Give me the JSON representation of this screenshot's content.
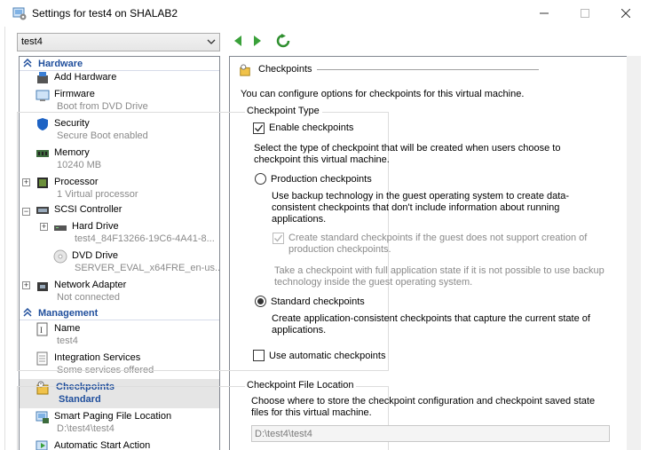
{
  "window": {
    "title": "Settings for test4 on SHALAB2"
  },
  "vm_selector": {
    "value": "test4"
  },
  "tree": {
    "hardware_label": "Hardware",
    "add_hardware": "Add Hardware",
    "firmware": {
      "name": "Firmware",
      "sub": "Boot from DVD Drive"
    },
    "security": {
      "name": "Security",
      "sub": "Secure Boot enabled"
    },
    "memory": {
      "name": "Memory",
      "sub": "10240 MB"
    },
    "processor": {
      "name": "Processor",
      "sub": "1 Virtual processor"
    },
    "scsi": {
      "name": "SCSI Controller"
    },
    "hard_drive": {
      "name": "Hard Drive",
      "sub": "test4_84F13266-19C6-4A41-8..."
    },
    "dvd_drive": {
      "name": "DVD Drive",
      "sub": "SERVER_EVAL_x64FRE_en-us...."
    },
    "network": {
      "name": "Network Adapter",
      "sub": "Not connected"
    },
    "management_label": "Management",
    "name_item": {
      "name": "Name",
      "sub": "test4"
    },
    "integration": {
      "name": "Integration Services",
      "sub": "Some services offered"
    },
    "checkpoints": {
      "name": "Checkpoints",
      "sub": "Standard"
    },
    "smart_paging": {
      "name": "Smart Paging File Location",
      "sub": "D:\\test4\\test4"
    },
    "auto_start": {
      "name": "Automatic Start Action"
    }
  },
  "panel": {
    "heading": "Checkpoints",
    "intro": "You can configure options for checkpoints for this virtual machine.",
    "checkpoint_type_legend": "Checkpoint Type",
    "enable_checkpoints": "Enable checkpoints",
    "select_type_text": "Select the type of checkpoint that will be created when users choose to checkpoint this virtual machine.",
    "production": "Production checkpoints",
    "production_desc": "Use backup technology in the guest operating system to create data-consistent checkpoints that don't include information about running applications.",
    "create_standard_if": "Create standard checkpoints if the guest does not support creation of production checkpoints.",
    "take_full_app": "Take a checkpoint with full application state if it is not possible to use backup technology inside the guest operating system.",
    "standard": "Standard checkpoints",
    "standard_desc": "Create application-consistent checkpoints that capture the current state of applications.",
    "automatic": "Use automatic checkpoints",
    "file_location_legend": "Checkpoint File Location",
    "file_location_desc": "Choose where to store the checkpoint configuration and checkpoint saved state files for this virtual machine.",
    "file_path": "D:\\test4\\test4"
  },
  "state": {
    "enable_checkpoints_checked": true,
    "create_standard_checked": true,
    "selected_type": "standard",
    "automatic_checked": false
  },
  "colors": {
    "accent": "#1f4e9c",
    "selected_bg": "#e5e5e5",
    "nav_arrow": "#3aa13a"
  }
}
